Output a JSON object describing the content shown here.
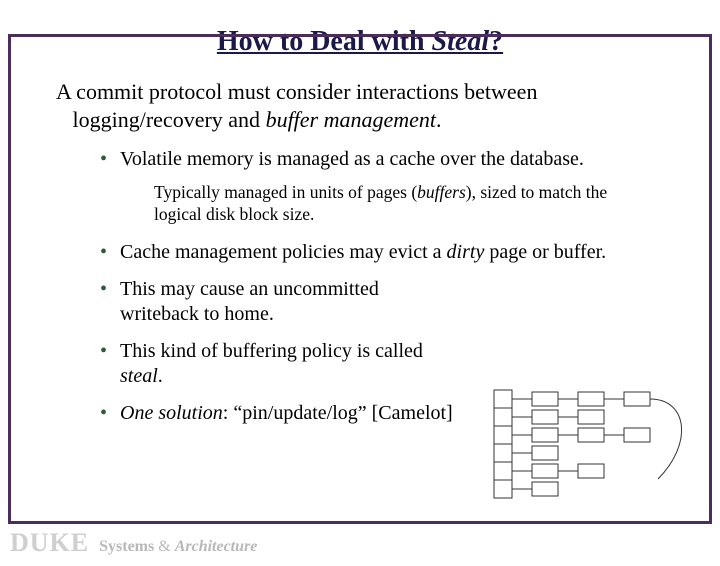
{
  "title": {
    "prefix": "How to Deal with ",
    "em": "Steal",
    "suffix": "?"
  },
  "intro": {
    "line1": "A commit protocol must consider interactions between",
    "line2_pre": "logging/recovery and ",
    "line2_em": "buffer management",
    "line2_post": "."
  },
  "bullets": {
    "b1": "Volatile memory is managed as a cache over the database.",
    "sub_pre": "Typically managed in units of pages (",
    "sub_em": "buffers",
    "sub_post": "), sized to match the logical disk block size.",
    "b2_pre": "Cache management policies may evict a ",
    "b2_em": "dirty",
    "b2_post": " page or buffer.",
    "b3": "This may cause an uncommitted writeback to home.",
    "b4_pre": "This kind of buffering policy is called ",
    "b4_em": "steal",
    "b4_post": ".",
    "b5_em": "One solution",
    "b5_post": ": “pin/update/log” [Camelot]"
  },
  "footer": {
    "duke": "DUKE",
    "systems": "Systems",
    "amp": " & ",
    "arch": "Architecture"
  }
}
